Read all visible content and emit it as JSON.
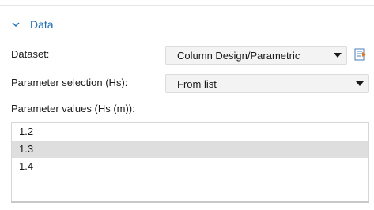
{
  "section": {
    "title": "Data",
    "expanded": true
  },
  "dataset": {
    "label": "Dataset:",
    "value": "Column Design/Parametric"
  },
  "parameter_selection": {
    "label": "Parameter selection (Hs):",
    "value": "From list"
  },
  "parameter_values": {
    "label": "Parameter values (Hs (m)):",
    "items": [
      "1.2",
      "1.3",
      "1.4"
    ],
    "selected_index": 1
  },
  "colors": {
    "accent": "#1f6fb2",
    "selected_row": "#dedede",
    "combo_bg": "#f3f3f3"
  },
  "icons": {
    "section_toggle": "chevron-down-icon",
    "combo_arrow": "triangle-down-icon",
    "dataset_action": "dataset-settings-icon"
  }
}
